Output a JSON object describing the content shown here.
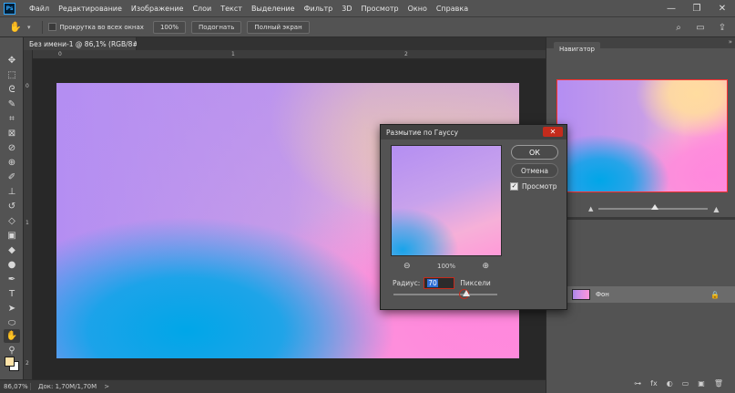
{
  "app": {
    "logo_text": "Ps",
    "menu": [
      "Файл",
      "Редактирование",
      "Изображение",
      "Слои",
      "Текст",
      "Выделение",
      "Фильтр",
      "3D",
      "Просмотр",
      "Окно",
      "Справка"
    ],
    "window_controls": {
      "minimize": "—",
      "maximize": "❐",
      "close": "✕"
    }
  },
  "options_bar": {
    "tool_icon": "hand-icon",
    "tool_glyph": "✋",
    "scroll_all_label": "Прокрутка во всех окнах",
    "buttons": [
      "100%",
      "Подогнать",
      "Полный экран"
    ]
  },
  "document": {
    "tab_title": "Без имени-1 @ 86,1% (RGB/8#) *",
    "close_glyph": "×",
    "ruler_marks_v": [
      "0",
      "1",
      "2"
    ],
    "ruler_marks_h": [
      "0",
      "1",
      "2"
    ]
  },
  "status": {
    "zoom": "86,07%",
    "doc_info": "Док: 1,70M/1,70M",
    "arrow": ">"
  },
  "navigator": {
    "tab_label": "Навигатор",
    "collapse_glyph": "»"
  },
  "layers": {
    "row_label": "Фон",
    "eye_glyph": "◉",
    "lock_glyph": "🔒",
    "footer_icons": [
      "fx",
      "◐",
      "▭",
      "▣",
      "🗑"
    ]
  },
  "dialog": {
    "title": "Размытие по Гауссу",
    "close_glyph": "✕",
    "ok_label": "ОК",
    "cancel_label": "Отмена",
    "preview_label": "Просмотр",
    "preview_checked": true,
    "zoom_out_glyph": "⊖",
    "zoom_in_glyph": "⊕",
    "zoom_percent": "100%",
    "radius_label": "Радиус:",
    "radius_value": "70",
    "radius_unit": "Пиксели",
    "checkmark": "✓"
  },
  "colors": {
    "foreground": "#ffe3a8",
    "background": "#ffffff",
    "accent_red": "#c42b1c",
    "selection_blue": "#2f6fd6"
  }
}
